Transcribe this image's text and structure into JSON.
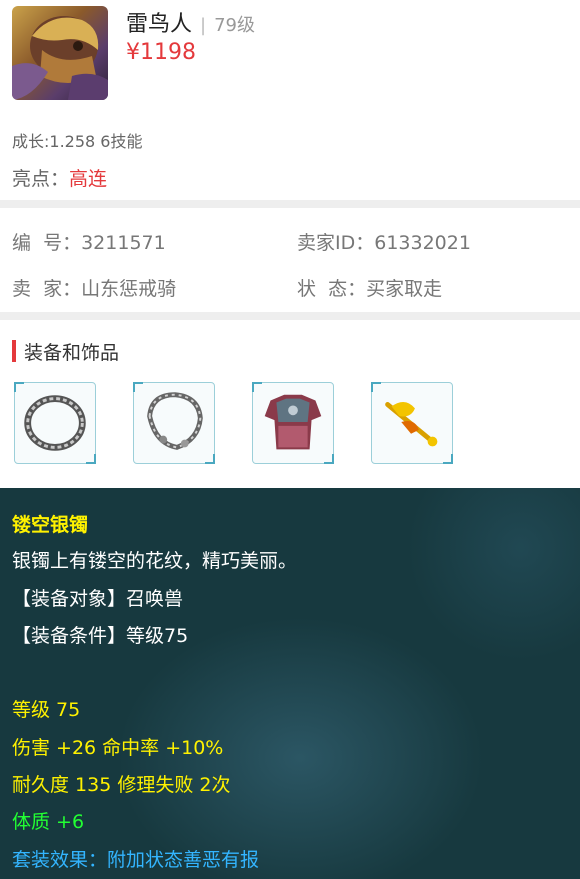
{
  "pet": {
    "name": "雷鸟人",
    "separator": "|",
    "level": "79级",
    "price": "¥1198",
    "growth": "成长:1.258 6技能",
    "highlight_label": "亮点：",
    "highlight_value": "高连"
  },
  "info": {
    "id_label": "编  号：",
    "id_value": "3211571",
    "seller_id_label": "卖家ID：",
    "seller_id_value": "61332021",
    "seller_label": "卖  家：",
    "seller_value": "山东惩戒骑",
    "status_label": "状  态：",
    "status_value": "买家取走"
  },
  "equipment": {
    "title": "装备和饰品",
    "slots": [
      {
        "icon": "silver-ring-icon"
      },
      {
        "icon": "hollow-silver-bracelet-icon"
      },
      {
        "icon": "armor-icon"
      },
      {
        "icon": "golden-phoenix-hairpin-icon"
      }
    ]
  },
  "tooltip": {
    "item_name": "镂空银镯",
    "description": "银镯上有镂空的花纹，精巧美丽。",
    "target": "【装备对象】召唤兽",
    "condition": "【装备条件】等级75",
    "level": "等级 75",
    "stats": "伤害 +26 命中率 +10%",
    "durability": "耐久度 135 修理失败 2次",
    "constitution": "体质 +6",
    "set_effect": "套装效果：附加状态善恶有报"
  },
  "colors": {
    "price_red": "#e4393c",
    "tooltip_bg": "#17393f",
    "title_yellow": "#fff200",
    "stat_green": "#22ff33",
    "set_blue": "#33b5ff"
  }
}
